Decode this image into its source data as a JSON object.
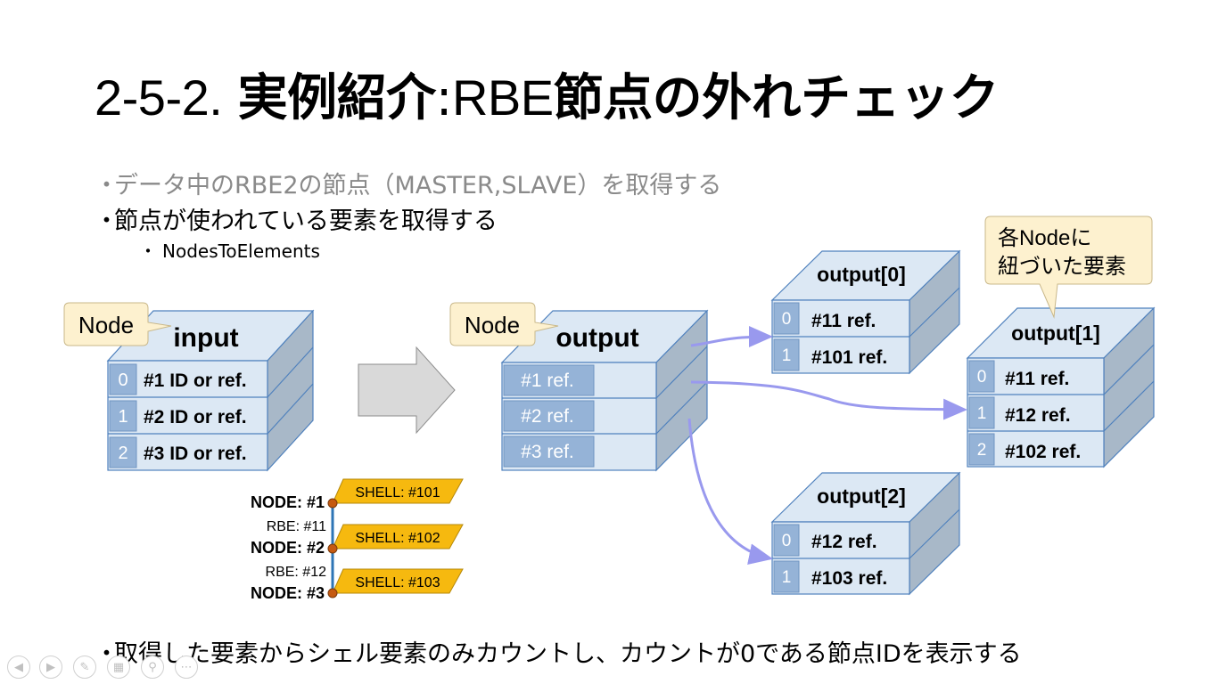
{
  "slide": {
    "title_num": "2-5-2.",
    "title_main": "実例紹介",
    "title_sep": ":",
    "title_rbe": "RBE",
    "title_rest": "節点の外れチェック",
    "bullet1": "データ中のRBE2の節点（MASTER,SLAVE）を取得する",
    "bullet2": "節点が使われている要素を取得する",
    "sub_bullet": "NodesToElements",
    "bullet3": "取得した要素からシェル要素のみカウントし、カウントが0である節点IDを表示する"
  },
  "diagram": {
    "callout_node_1": "Node",
    "callout_node_2": "Node",
    "callout_each_line1": "各Nodeに",
    "callout_each_line2": "紐づいた要素",
    "input": {
      "title": "input",
      "rows": [
        {
          "idx": "0",
          "label": "#1 ID or ref."
        },
        {
          "idx": "1",
          "label": "#2 ID or ref."
        },
        {
          "idx": "2",
          "label": "#3 ID or ref."
        }
      ]
    },
    "output": {
      "title": "output",
      "rows": [
        "#1 ref.",
        "#2 ref.",
        "#3 ref."
      ]
    },
    "output0": {
      "title": "output[0]",
      "rows": [
        {
          "idx": "0",
          "label": "#11 ref."
        },
        {
          "idx": "1",
          "label": "#101 ref."
        }
      ]
    },
    "output1": {
      "title": "output[1]",
      "rows": [
        {
          "idx": "0",
          "label": "#11 ref."
        },
        {
          "idx": "1",
          "label": "#12 ref."
        },
        {
          "idx": "2",
          "label": "#102 ref."
        }
      ]
    },
    "output2": {
      "title": "output[2]",
      "rows": [
        {
          "idx": "0",
          "label": "#12 ref."
        },
        {
          "idx": "1",
          "label": "#103 ref."
        }
      ]
    },
    "model": {
      "node1": "NODE: #1",
      "node2": "NODE: #2",
      "node3": "NODE: #3",
      "rbe1": "RBE: #11",
      "rbe2": "RBE: #12",
      "shell1": "SHELL: #101",
      "shell2": "SHELL: #102",
      "shell3": "SHELL: #103"
    }
  },
  "colors": {
    "cube_front": "#dce8f4",
    "cube_top": "#dce8f4",
    "cube_side": "#a8b8c8",
    "cube_border": "#4f81bd",
    "index_cell": "#95b3d7",
    "callout": "#fdf1cf",
    "callout_border": "#c9b88a",
    "arrow_fill": "#d9d9d9",
    "connector": "#9999ee",
    "shell": "#f6b90f",
    "node_dot": "#c55a11",
    "rbe_line": "#2e75b6",
    "bullet_gray": "#8a8a8a"
  },
  "nav_icons": [
    "prev-icon",
    "next-icon",
    "pen-icon",
    "slides-icon",
    "zoom-icon",
    "more-icon"
  ]
}
